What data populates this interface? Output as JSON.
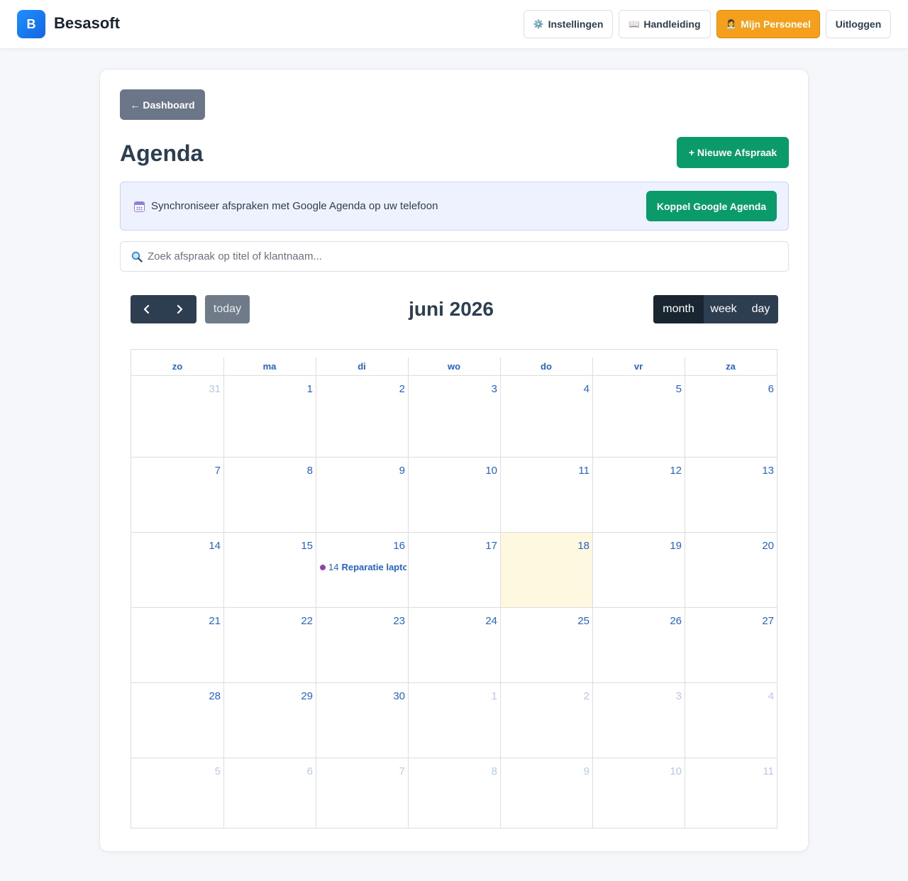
{
  "header": {
    "logo_letter": "B",
    "brand": "Besasoft",
    "buttons": {
      "settings_icon": "⚙️",
      "settings": "Instellingen",
      "manual_icon": "📖",
      "manual": "Handleiding",
      "staff_icon": "👩‍💼",
      "staff": "Mijn Personeel",
      "logout": "Uitloggen"
    }
  },
  "page": {
    "back_button": "← Dashboard",
    "title": "Agenda",
    "new_button": "+ Nieuwe Afspraak"
  },
  "google_banner": {
    "icon": "calendar-icon",
    "text": "Synchroniseer afspraken met Google Agenda op uw telefoon",
    "button": "Koppel Google Agenda"
  },
  "search": {
    "placeholder": "Zoek afspraak op titel of klantnaam...",
    "value": ""
  },
  "calendar": {
    "title": "juni 2026",
    "today_button": "today",
    "views": [
      "month",
      "week",
      "day"
    ],
    "active_view": "month",
    "weekdays": [
      "zo",
      "ma",
      "di",
      "wo",
      "do",
      "vr",
      "za"
    ],
    "weeks": [
      [
        {
          "d": "31",
          "o": true
        },
        {
          "d": "1"
        },
        {
          "d": "2"
        },
        {
          "d": "3"
        },
        {
          "d": "4"
        },
        {
          "d": "5"
        },
        {
          "d": "6"
        }
      ],
      [
        {
          "d": "7"
        },
        {
          "d": "8"
        },
        {
          "d": "9"
        },
        {
          "d": "10"
        },
        {
          "d": "11"
        },
        {
          "d": "12"
        },
        {
          "d": "13"
        }
      ],
      [
        {
          "d": "14"
        },
        {
          "d": "15"
        },
        {
          "d": "16"
        },
        {
          "d": "17"
        },
        {
          "d": "18",
          "today": true
        },
        {
          "d": "19"
        },
        {
          "d": "20"
        }
      ],
      [
        {
          "d": "21"
        },
        {
          "d": "22"
        },
        {
          "d": "23"
        },
        {
          "d": "24"
        },
        {
          "d": "25"
        },
        {
          "d": "26"
        },
        {
          "d": "27"
        }
      ],
      [
        {
          "d": "28"
        },
        {
          "d": "29"
        },
        {
          "d": "30"
        },
        {
          "d": "1",
          "o": true
        },
        {
          "d": "2",
          "o": true
        },
        {
          "d": "3",
          "o": true
        },
        {
          "d": "4",
          "o": true
        }
      ],
      [
        {
          "d": "5",
          "o": true
        },
        {
          "d": "6",
          "o": true
        },
        {
          "d": "7",
          "o": true
        },
        {
          "d": "8",
          "o": true
        },
        {
          "d": "9",
          "o": true
        },
        {
          "d": "10",
          "o": true
        },
        {
          "d": "11",
          "o": true
        }
      ]
    ],
    "events": [
      {
        "week": 2,
        "day": 2,
        "time": "14",
        "title": "Reparatie laptop",
        "color": "#8e44ad"
      }
    ],
    "colors": {
      "toolbar": "#2c3e50",
      "link": "#2563c9",
      "today_bg": "#fdf8df"
    }
  }
}
